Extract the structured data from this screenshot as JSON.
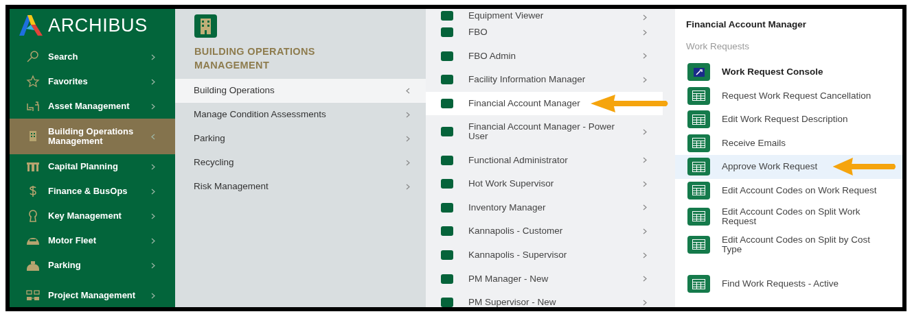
{
  "logo": {
    "text": "ARCHIBUS"
  },
  "sidebar": {
    "items": [
      {
        "label": "Search",
        "kind": "search",
        "selected": false
      },
      {
        "label": "Favorites",
        "kind": "star",
        "selected": false
      },
      {
        "label": "Asset Management",
        "kind": "assets",
        "selected": false
      },
      {
        "label": "Building Operations Management",
        "kind": "building",
        "selected": true
      },
      {
        "label": "Capital Planning",
        "kind": "columns",
        "selected": false
      },
      {
        "label": "Finance & BusOps",
        "kind": "dollar",
        "selected": false
      },
      {
        "label": "Key Management",
        "kind": "keyhole",
        "selected": false
      },
      {
        "label": "Motor Fleet",
        "kind": "car",
        "selected": false
      },
      {
        "label": "Parking",
        "kind": "parking",
        "selected": false
      },
      {
        "label": "Project Management",
        "kind": "network",
        "selected": false
      }
    ]
  },
  "process_panel": {
    "title": "BUILDING OPERATIONS MANAGEMENT",
    "items": [
      {
        "label": "Building Operations",
        "selected": true
      },
      {
        "label": "Manage Condition Assessments",
        "selected": false
      },
      {
        "label": "Parking",
        "selected": false
      },
      {
        "label": "Recycling",
        "selected": false
      },
      {
        "label": "Risk Management",
        "selected": false
      }
    ]
  },
  "role_panel": {
    "items": [
      {
        "label": "Equipment Viewer",
        "selected": false,
        "pointed": false
      },
      {
        "label": "FBO",
        "selected": false,
        "pointed": false
      },
      {
        "label": "FBO Admin",
        "selected": false,
        "pointed": false
      },
      {
        "label": "Facility Information Manager",
        "selected": false,
        "pointed": false
      },
      {
        "label": "Financial Account Manager",
        "selected": true,
        "pointed": true
      },
      {
        "label": "Financial Account Manager - Power User",
        "selected": false,
        "pointed": false
      },
      {
        "label": "Functional Administrator",
        "selected": false,
        "pointed": false
      },
      {
        "label": "Hot Work Supervisor",
        "selected": false,
        "pointed": false
      },
      {
        "label": "Inventory Manager",
        "selected": false,
        "pointed": false
      },
      {
        "label": "Kannapolis - Customer",
        "selected": false,
        "pointed": false
      },
      {
        "label": "Kannapolis - Supervisor",
        "selected": false,
        "pointed": false
      },
      {
        "label": "PM Manager - New",
        "selected": false,
        "pointed": false
      },
      {
        "label": "PM Supervisor - New",
        "selected": false,
        "pointed": false
      }
    ]
  },
  "task_panel": {
    "title": "Financial Account Manager",
    "section": "Work Requests",
    "items": [
      {
        "label": "Work Request Console",
        "kind": "console",
        "selected": false,
        "pointed": false,
        "separated": false
      },
      {
        "label": "Request Work Request Cancellation",
        "kind": "report",
        "selected": false,
        "pointed": false,
        "separated": false
      },
      {
        "label": "Edit Work Request Description",
        "kind": "report",
        "selected": false,
        "pointed": false,
        "separated": false
      },
      {
        "label": "Receive Emails",
        "kind": "report",
        "selected": false,
        "pointed": false,
        "separated": false
      },
      {
        "label": "Approve Work Request",
        "kind": "report",
        "selected": true,
        "pointed": true,
        "separated": false
      },
      {
        "label": "Edit Account Codes on Work Request",
        "kind": "report",
        "selected": false,
        "pointed": false,
        "separated": false
      },
      {
        "label": "Edit Account Codes on Split Work Request",
        "kind": "report",
        "selected": false,
        "pointed": false,
        "separated": false
      },
      {
        "label": "Edit Account Codes on Split by Cost Type",
        "kind": "report",
        "selected": false,
        "pointed": false,
        "separated": false
      },
      {
        "label": "Find Work Requests - Active",
        "kind": "report",
        "selected": false,
        "pointed": false,
        "separated": true
      }
    ]
  }
}
